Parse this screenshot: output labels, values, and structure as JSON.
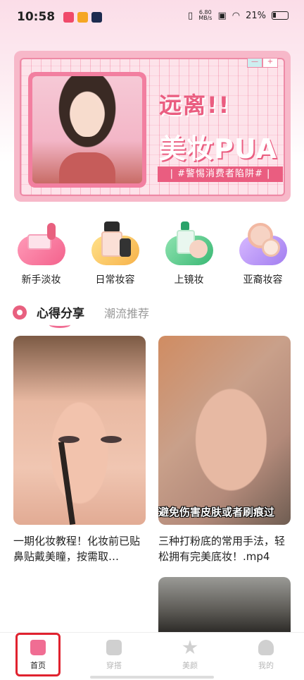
{
  "status_bar": {
    "time": "10:58",
    "net_speed_value": "6.80",
    "net_speed_unit": "MB/s",
    "battery": "21%"
  },
  "banner": {
    "headline": "远离!!",
    "title": "美妆PUA",
    "tag": "| #警惕消费者陷阱# |",
    "minimize": "—",
    "maximize": "+"
  },
  "categories": [
    {
      "label": "新手淡妆"
    },
    {
      "label": "日常妆容"
    },
    {
      "label": "上镜妆"
    },
    {
      "label": "亚裔妆容"
    }
  ],
  "tabs": {
    "active": "心得分享",
    "inactive": "潮流推荐"
  },
  "cards": [
    {
      "title": "一期化妆教程！化妆前已贴鼻贴戴美瞳，按需取…"
    },
    {
      "overlay": "避免伤害皮肤或者刷痕过",
      "title": "三种打粉底的常用手法，轻松拥有完美底妆！.mp4"
    }
  ],
  "nav": {
    "items": [
      {
        "label": "首页"
      },
      {
        "label": "穿搭"
      },
      {
        "label": "美颜"
      },
      {
        "label": "我的"
      }
    ]
  },
  "colors": {
    "accent": "#f06d93",
    "banner_pink": "#ea5d80",
    "highlight_box": "#e0222f"
  }
}
